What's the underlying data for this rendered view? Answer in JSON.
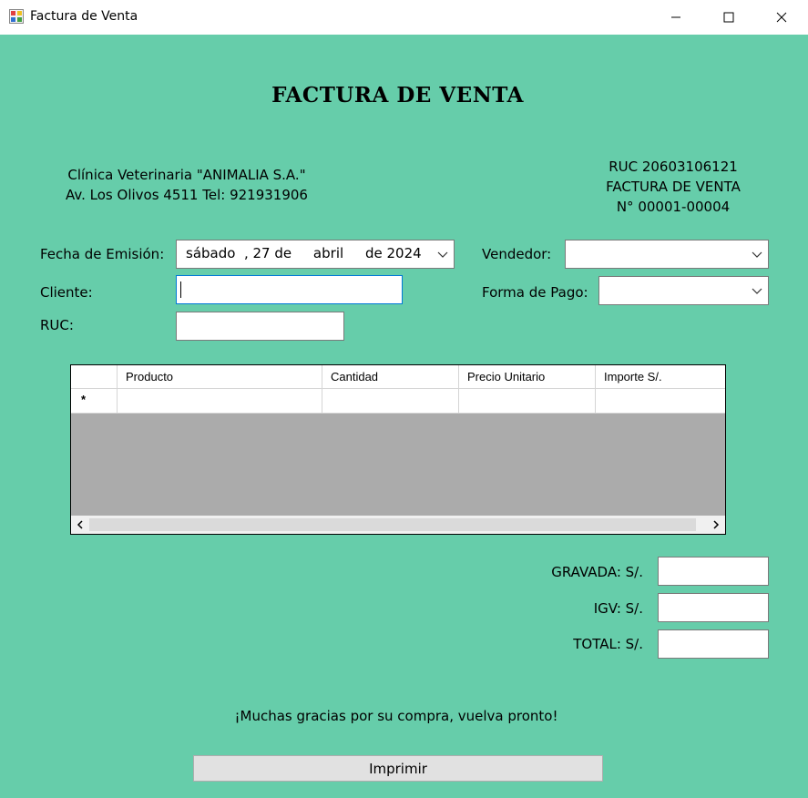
{
  "window": {
    "title": "Factura de Venta"
  },
  "form": {
    "heading": "FACTURA DE VENTA",
    "company": {
      "name": "Clínica Veterinaria \"ANIMALIA S.A.\"",
      "address": "Av.  Los Olivos 4511  Tel: 921931906"
    },
    "invoice": {
      "ruc": "RUC 20603106121",
      "type": "FACTURA DE VENTA",
      "number": "N° 00001-00004"
    },
    "fecha_label": "Fecha de Emisión:",
    "fecha_value": "sábado  , 27 de     abril     de 2024",
    "vendedor_label": "Vendedor:",
    "vendedor_value": "",
    "cliente_label": "Cliente:",
    "cliente_value": "",
    "forma_pago_label": "Forma de Pago:",
    "forma_pago_value": "",
    "ruc_label": "RUC:",
    "ruc_value": "",
    "grid": {
      "columns": [
        "Producto",
        "Cantidad",
        "Precio Unitario",
        "Importe S/."
      ],
      "new_row_marker": "*"
    },
    "totals": {
      "gravada_label": "GRAVADA: S/.",
      "gravada_value": "",
      "igv_label": "IGV: S/.",
      "igv_value": "",
      "total_label": "TOTAL: S/.",
      "total_value": ""
    },
    "thanks": "¡Muchas gracias por su compra, vuelva pronto!",
    "print_button": "Imprimir"
  },
  "colors": {
    "background": "#66cdaa",
    "grid_empty": "#ababab"
  }
}
